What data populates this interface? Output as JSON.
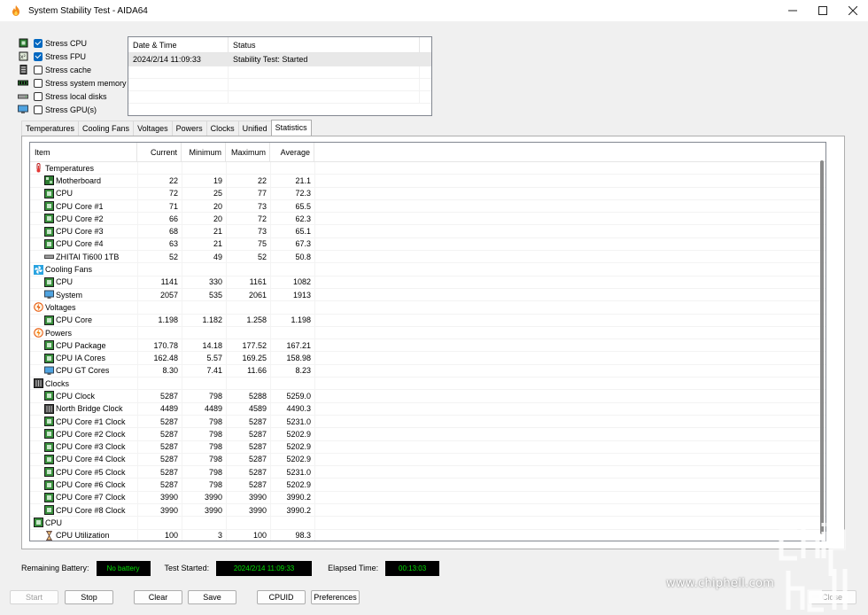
{
  "window": {
    "title": "System Stability Test - AIDA64"
  },
  "stress": [
    {
      "label": "Stress CPU",
      "checked": true,
      "icon": "cpu-chip-icon"
    },
    {
      "label": "Stress FPU",
      "checked": true,
      "icon": "fpu-icon"
    },
    {
      "label": "Stress cache",
      "checked": false,
      "icon": "cache-icon"
    },
    {
      "label": "Stress system memory",
      "checked": false,
      "icon": "memory-icon"
    },
    {
      "label": "Stress local disks",
      "checked": false,
      "icon": "disk-icon"
    },
    {
      "label": "Stress GPU(s)",
      "checked": false,
      "icon": "monitor-icon"
    }
  ],
  "log": {
    "col_datetime": "Date & Time",
    "col_status": "Status",
    "entry_datetime": "2024/2/14 11:09:33",
    "entry_status": "Stability Test: Started"
  },
  "tabs": [
    "Temperatures",
    "Cooling Fans",
    "Voltages",
    "Powers",
    "Clocks",
    "Unified",
    "Statistics"
  ],
  "grid": {
    "headers": {
      "item": "Item",
      "current": "Current",
      "minimum": "Minimum",
      "maximum": "Maximum",
      "average": "Average"
    },
    "rows": [
      {
        "type": "group",
        "label": "Temperatures",
        "icon": "thermometer-icon"
      },
      {
        "type": "child",
        "label": "Motherboard",
        "icon": "motherboard-icon",
        "v": [
          "22",
          "19",
          "22",
          "21.1"
        ]
      },
      {
        "type": "child",
        "label": "CPU",
        "icon": "chip-icon",
        "v": [
          "72",
          "25",
          "77",
          "72.3"
        ]
      },
      {
        "type": "child",
        "label": "CPU Core #1",
        "icon": "chip-icon",
        "v": [
          "71",
          "20",
          "73",
          "65.5"
        ]
      },
      {
        "type": "child",
        "label": "CPU Core #2",
        "icon": "chip-icon",
        "v": [
          "66",
          "20",
          "72",
          "62.3"
        ]
      },
      {
        "type": "child",
        "label": "CPU Core #3",
        "icon": "chip-icon",
        "v": [
          "68",
          "21",
          "73",
          "65.1"
        ]
      },
      {
        "type": "child",
        "label": "CPU Core #4",
        "icon": "chip-icon",
        "v": [
          "63",
          "21",
          "75",
          "67.3"
        ]
      },
      {
        "type": "child",
        "label": "ZHITAI Ti600 1TB",
        "icon": "disk-icon",
        "v": [
          "52",
          "49",
          "52",
          "50.8"
        ]
      },
      {
        "type": "group",
        "label": "Cooling Fans",
        "icon": "fan-icon"
      },
      {
        "type": "child",
        "label": "CPU",
        "icon": "chip-icon",
        "v": [
          "1141",
          "330",
          "1161",
          "1082"
        ]
      },
      {
        "type": "child",
        "label": "System",
        "icon": "monitor-icon",
        "v": [
          "2057",
          "535",
          "2061",
          "1913"
        ]
      },
      {
        "type": "group",
        "label": "Voltages",
        "icon": "voltage-icon"
      },
      {
        "type": "child",
        "label": "CPU Core",
        "icon": "chip-icon",
        "v": [
          "1.198",
          "1.182",
          "1.258",
          "1.198"
        ]
      },
      {
        "type": "group",
        "label": "Powers",
        "icon": "power-icon"
      },
      {
        "type": "child",
        "label": "CPU Package",
        "icon": "chip-icon",
        "v": [
          "170.78",
          "14.18",
          "177.52",
          "167.21"
        ]
      },
      {
        "type": "child",
        "label": "CPU IA Cores",
        "icon": "chip-icon",
        "v": [
          "162.48",
          "5.57",
          "169.25",
          "158.98"
        ]
      },
      {
        "type": "child",
        "label": "CPU GT Cores",
        "icon": "monitor-icon",
        "v": [
          "8.30",
          "7.41",
          "11.66",
          "8.23"
        ]
      },
      {
        "type": "group",
        "label": "Clocks",
        "icon": "clock-board-icon"
      },
      {
        "type": "child",
        "label": "CPU Clock",
        "icon": "chip-icon",
        "v": [
          "5287",
          "798",
          "5288",
          "5259.0"
        ]
      },
      {
        "type": "child",
        "label": "North Bridge Clock",
        "icon": "clock-board-icon",
        "v": [
          "4489",
          "4489",
          "4589",
          "4490.3"
        ]
      },
      {
        "type": "child",
        "label": "CPU Core #1 Clock",
        "icon": "chip-icon",
        "v": [
          "5287",
          "798",
          "5287",
          "5231.0"
        ]
      },
      {
        "type": "child",
        "label": "CPU Core #2 Clock",
        "icon": "chip-icon",
        "v": [
          "5287",
          "798",
          "5287",
          "5202.9"
        ]
      },
      {
        "type": "child",
        "label": "CPU Core #3 Clock",
        "icon": "chip-icon",
        "v": [
          "5287",
          "798",
          "5287",
          "5202.9"
        ]
      },
      {
        "type": "child",
        "label": "CPU Core #4 Clock",
        "icon": "chip-icon",
        "v": [
          "5287",
          "798",
          "5287",
          "5202.9"
        ]
      },
      {
        "type": "child",
        "label": "CPU Core #5 Clock",
        "icon": "chip-icon",
        "v": [
          "5287",
          "798",
          "5287",
          "5231.0"
        ]
      },
      {
        "type": "child",
        "label": "CPU Core #6 Clock",
        "icon": "chip-icon",
        "v": [
          "5287",
          "798",
          "5287",
          "5202.9"
        ]
      },
      {
        "type": "child",
        "label": "CPU Core #7 Clock",
        "icon": "chip-icon",
        "v": [
          "3990",
          "3990",
          "3990",
          "3990.2"
        ]
      },
      {
        "type": "child",
        "label": "CPU Core #8 Clock",
        "icon": "chip-icon",
        "v": [
          "3990",
          "3990",
          "3990",
          "3990.2"
        ]
      },
      {
        "type": "group",
        "label": "CPU",
        "icon": "chip-icon"
      },
      {
        "type": "child",
        "label": "CPU Utilization",
        "icon": "hourglass-icon",
        "v": [
          "100",
          "3",
          "100",
          "98.3"
        ]
      }
    ]
  },
  "status": {
    "battery_label": "Remaining Battery:",
    "battery_value": "No battery",
    "started_label": "Test Started:",
    "started_value": "2024/2/14 11:09:33",
    "elapsed_label": "Elapsed Time:",
    "elapsed_value": "00:13:03"
  },
  "buttons": {
    "start": "Start",
    "stop": "Stop",
    "clear": "Clear",
    "save": "Save",
    "cpuid": "CPUID",
    "preferences": "Preferences",
    "close": "Close"
  },
  "watermark": {
    "url": "www.chiphell.com",
    "logo": "chip hell"
  },
  "colors": {
    "accent": "#0067c0",
    "status_bg": "#000000",
    "status_fg": "#00e000"
  }
}
